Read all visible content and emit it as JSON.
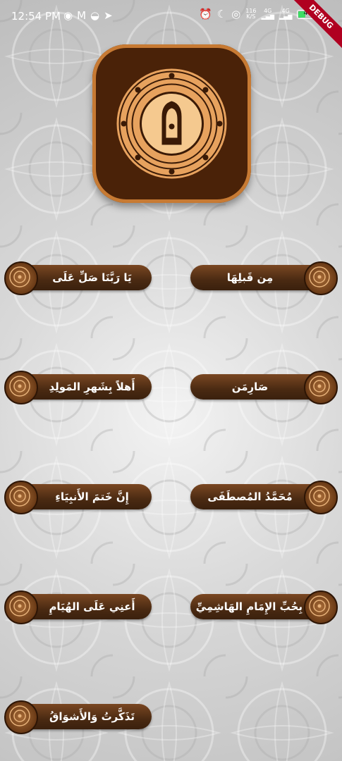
{
  "status_bar": {
    "time": "12:54 PM",
    "speed_value": "116",
    "speed_unit": "K/S",
    "net1": "4G",
    "net2": "4G",
    "battery": "4"
  },
  "debug_banner": "DEBUG",
  "buttons_left": [
    {
      "label": "يَا رَبَّنَا صَلِّ عَلَى"
    },
    {
      "label": "أَهلاً بِشَهرِ المَولِدِ"
    },
    {
      "label": "إِنَّ خَتمَ الأَنبِيَاءِ"
    },
    {
      "label": "أَعنِي عَلَى الهُيَامِ"
    },
    {
      "label": "تَذَكَّرتُ وَالأَشوَاقُ"
    }
  ],
  "buttons_right": [
    {
      "label": "مِن قَبلِهَا"
    },
    {
      "label": "صَارِمَن"
    },
    {
      "label": "مُحَمَّدُ المُصطَفَى"
    },
    {
      "label": "بِحُبِّ الإِمَامِ الهَاشِمِيِّ"
    }
  ],
  "colors": {
    "button_brown": "#4a2a12",
    "logo_bg": "#4a2208",
    "logo_border": "#c77a33"
  }
}
